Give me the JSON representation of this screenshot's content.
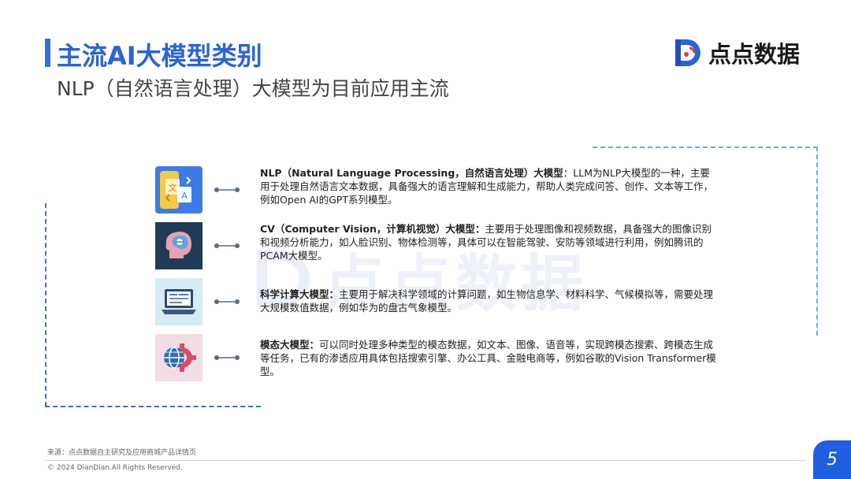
{
  "header": {
    "title": "主流AI大模型类别",
    "subtitle": "NLP（自然语言处理）大模型为目前应用主流"
  },
  "brand": {
    "name": "点点数据",
    "accent": "#2a64d8",
    "logo_icon": "dd-logo-icon"
  },
  "items": [
    {
      "icon": "translate-icon",
      "heading": "NLP（Natural Language Processing，自然语言处理）大模型",
      "body": "：LLM为NLP大模型的一种，主要用于处理自然语言文本数据，具备强大的语言理解和生成能力，帮助人类完成问答、创作、文本等工作，例如Open AI的GPT系列模型。"
    },
    {
      "icon": "ai-head-icon",
      "heading": "CV（Computer Vision，计算机视觉）大模型：",
      "body": "主要用于处理图像和视频数据，具备强大的图像识别和视频分析能力，如人脸识别、物体检测等，具体可以在智能驾驶、安防等领域进行利用，例如腾讯的PCAM大模型。"
    },
    {
      "icon": "laptop-code-icon",
      "heading": "科学计算大模型：",
      "body": "主要用于解决科学领域的计算问题，如生物信息学、材料科学、气候模拟等，需要处理大规模数值数据，例如华为的盘古气象模型。"
    },
    {
      "icon": "globe-gear-icon",
      "heading": "模态大模型：",
      "body": "可以同时处理多种类型的模态数据，如文本、图像、语音等，实现跨模态搜索、跨模态生成等任务，已有的渗透应用具体包括搜索引擎、办公工具、金融电商等，例如谷歌的Vision Transformer模型。"
    }
  ],
  "footer": {
    "source": "来源：点点数据自主研究及应用商城产品详情页",
    "copyright": "© 2024 DianDian.All Rights Reserved.",
    "page": "5"
  }
}
